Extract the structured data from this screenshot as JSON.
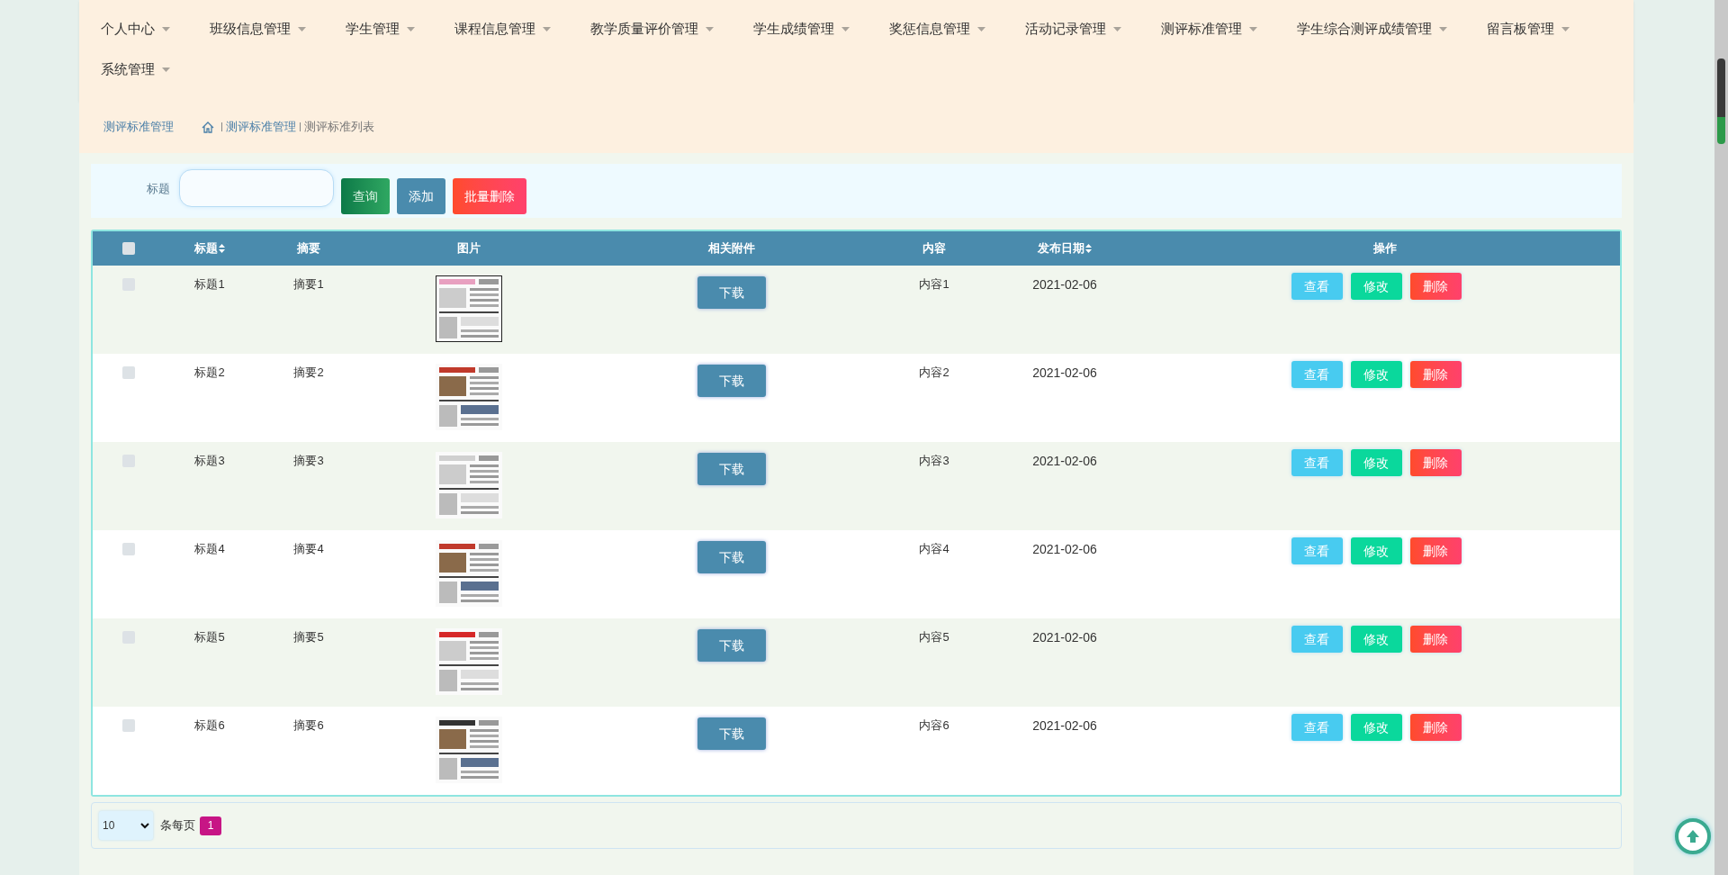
{
  "nav": {
    "items": [
      {
        "label": "个人中心"
      },
      {
        "label": "班级信息管理"
      },
      {
        "label": "学生管理"
      },
      {
        "label": "课程信息管理"
      },
      {
        "label": "教学质量评价管理"
      },
      {
        "label": "学生成绩管理"
      },
      {
        "label": "奖惩信息管理"
      },
      {
        "label": "活动记录管理"
      },
      {
        "label": "测评标准管理"
      },
      {
        "label": "学生综合测评成绩管理"
      },
      {
        "label": "留言板管理"
      },
      {
        "label": "系统管理"
      }
    ]
  },
  "breadcrumb": {
    "title": "测评标准管理",
    "path": [
      "测评标准管理",
      "测评标准列表"
    ]
  },
  "search": {
    "label": "标题",
    "buttons": [
      {
        "label": "查询",
        "kind": "search"
      },
      {
        "label": "添加",
        "kind": "add"
      },
      {
        "label": "批量删除",
        "kind": "delete"
      }
    ]
  },
  "table": {
    "columns": [
      {
        "kind": "checkbox",
        "checked": false
      },
      {
        "label": "标题",
        "sortable": true
      },
      {
        "label": "摘要",
        "sortable": false
      },
      {
        "label": "图片",
        "sortable": false
      },
      {
        "label": "相关附件",
        "sortable": false
      },
      {
        "label": "内容",
        "sortable": false
      },
      {
        "label": "发布日期",
        "sortable": true
      },
      {
        "label": "操作",
        "sortable": false
      }
    ],
    "rows": [
      {
        "checked": false,
        "title": "标题1",
        "summary": "摘要1",
        "attachment": "下载",
        "content": "内容1",
        "date": "2021-02-06",
        "actions": [
          "查看",
          "修改",
          "删除"
        ]
      },
      {
        "checked": false,
        "title": "标题2",
        "summary": "摘要2",
        "attachment": "下载",
        "content": "内容2",
        "date": "2021-02-06",
        "actions": [
          "查看",
          "修改",
          "删除"
        ]
      },
      {
        "checked": false,
        "title": "标题3",
        "summary": "摘要3",
        "attachment": "下载",
        "content": "内容3",
        "date": "2021-02-06",
        "actions": [
          "查看",
          "修改",
          "删除"
        ]
      },
      {
        "checked": false,
        "title": "标题4",
        "summary": "摘要4",
        "attachment": "下载",
        "content": "内容4",
        "date": "2021-02-06",
        "actions": [
          "查看",
          "修改",
          "删除"
        ]
      },
      {
        "checked": false,
        "title": "标题5",
        "summary": "摘要5",
        "attachment": "下载",
        "content": "内容5",
        "date": "2021-02-06",
        "actions": [
          "查看",
          "修改",
          "删除"
        ]
      },
      {
        "checked": false,
        "title": "标题6",
        "summary": "摘要6",
        "attachment": "下载",
        "content": "内容6",
        "date": "2021-02-06",
        "actions": [
          "查看",
          "修改",
          "删除"
        ]
      }
    ]
  },
  "pagination": {
    "page_size": "10",
    "per_page_label": "条每页",
    "pages": [
      {
        "label": "1",
        "selected": true
      }
    ]
  }
}
